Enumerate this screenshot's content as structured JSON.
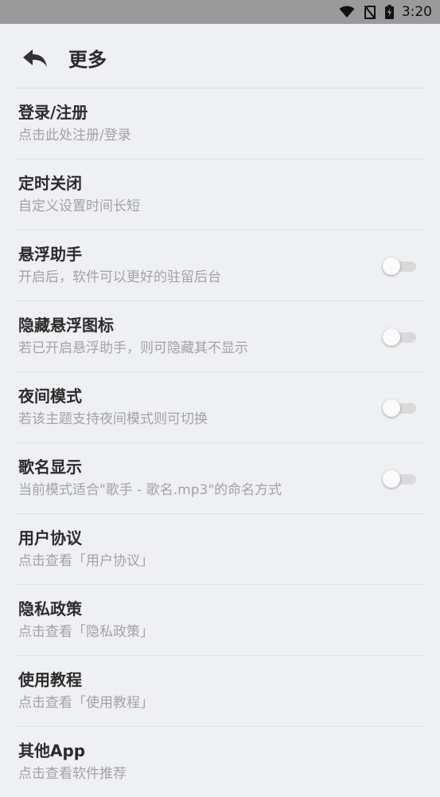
{
  "status_bar": {
    "time": "3:20",
    "icons": [
      "wifi-icon",
      "no-sim-icon",
      "battery-charging-icon"
    ]
  },
  "header": {
    "title": "更多",
    "back_icon": "back-arrow-icon"
  },
  "items": [
    {
      "title": "登录/注册",
      "subtitle": "点击此处注册/登录",
      "toggle": null
    },
    {
      "title": "定时关闭",
      "subtitle": "自定义设置时间长短",
      "toggle": null
    },
    {
      "title": "悬浮助手",
      "subtitle": "开启后，软件可以更好的驻留后台",
      "toggle": "off"
    },
    {
      "title": "隐藏悬浮图标",
      "subtitle": "若已开启悬浮助手，则可隐藏其不显示",
      "toggle": "off"
    },
    {
      "title": "夜间模式",
      "subtitle": "若该主题支持夜间模式则可切换",
      "toggle": "off"
    },
    {
      "title": "歌名显示",
      "subtitle": "当前模式适合\"歌手 - 歌名.mp3\"的命名方式",
      "toggle": "off"
    },
    {
      "title": "用户协议",
      "subtitle": "点击查看「用户协议」",
      "toggle": null
    },
    {
      "title": "隐私政策",
      "subtitle": "点击查看「隐私政策」",
      "toggle": null
    },
    {
      "title": "使用教程",
      "subtitle": "点击查看「使用教程」",
      "toggle": null
    },
    {
      "title": "其他App",
      "subtitle": "点击查看软件推荐",
      "toggle": null
    }
  ],
  "colors": {
    "background": "#eef0f3",
    "status_bar": "#9a9a9a",
    "title_text": "#2b2b2b",
    "subtitle_text": "#a3a3a3",
    "toggle_track_off": "#d9d9d9"
  }
}
